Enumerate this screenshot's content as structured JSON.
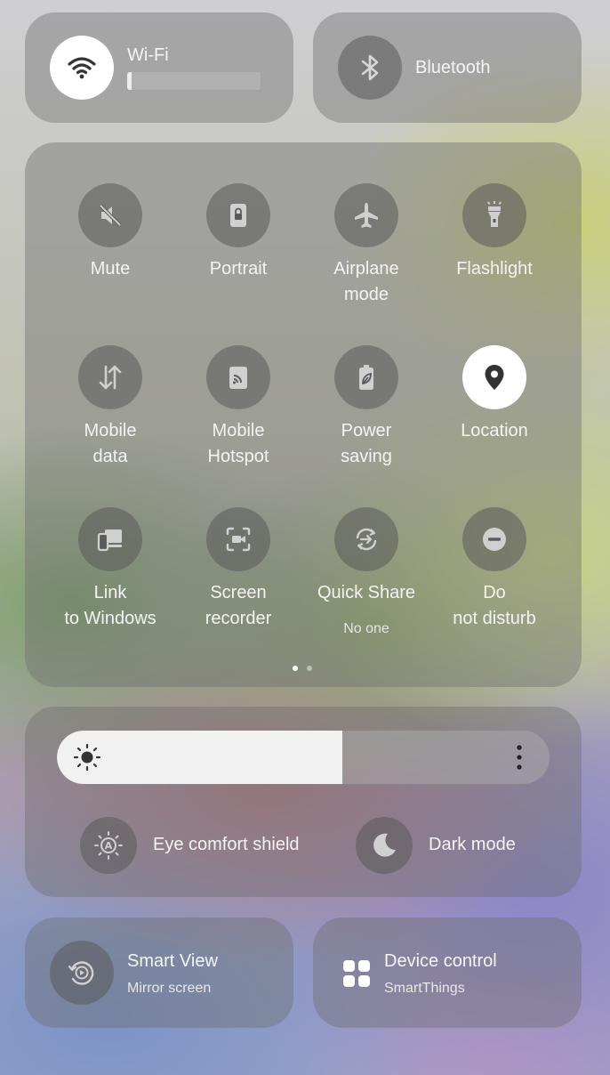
{
  "wifi": {
    "label": "Wi-Fi",
    "icon": "wifi-icon",
    "active": true
  },
  "bluetooth": {
    "label": "Bluetooth",
    "icon": "bluetooth-icon",
    "active": false
  },
  "tiles": [
    {
      "label": "Mute",
      "icon": "mute-icon",
      "active": false
    },
    {
      "label": "Portrait",
      "icon": "portrait-lock-icon",
      "active": false
    },
    {
      "label": "Airplane mode",
      "icon": "airplane-icon",
      "active": false
    },
    {
      "label": "Flashlight",
      "icon": "flashlight-icon",
      "active": false
    },
    {
      "label": "Mobile data",
      "icon": "mobile-data-icon",
      "active": false
    },
    {
      "label": "Mobile Hotspot",
      "icon": "hotspot-icon",
      "active": false
    },
    {
      "label": "Power saving",
      "icon": "power-saving-icon",
      "active": false
    },
    {
      "label": "Location",
      "icon": "location-icon",
      "active": true
    },
    {
      "label": "Link to Windows",
      "icon": "link-to-windows-icon",
      "active": false
    },
    {
      "label": "Screen recorder",
      "icon": "screen-recorder-icon",
      "active": false
    },
    {
      "label": "Quick Share",
      "sub": "No one",
      "icon": "quick-share-icon",
      "active": false
    },
    {
      "label": "Do not disturb",
      "icon": "do-not-disturb-icon",
      "active": false
    }
  ],
  "page_indicator": {
    "current": 1,
    "total": 2
  },
  "brightness": {
    "level_fraction": 0.58,
    "icon": "sun-icon"
  },
  "eye_comfort": {
    "label": "Eye comfort shield",
    "icon": "eye-comfort-icon"
  },
  "dark_mode": {
    "label": "Dark mode",
    "icon": "moon-icon"
  },
  "smart_view": {
    "title": "Smart View",
    "subtitle": "Mirror screen",
    "icon": "smart-view-icon"
  },
  "device_control": {
    "title": "Device control",
    "subtitle": "SmartThings",
    "icon": "device-control-icon"
  },
  "colors": {
    "active_circle": "#ffffff",
    "inactive_circle": "#5a5a5a",
    "text": "#ffffff"
  }
}
